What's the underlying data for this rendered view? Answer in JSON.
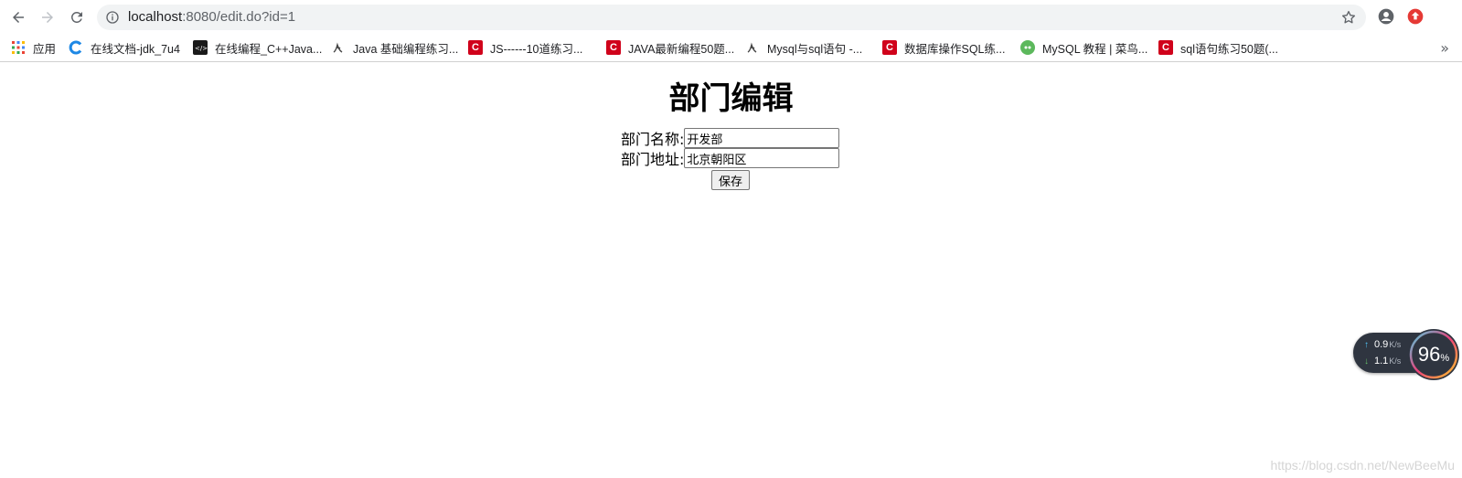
{
  "browser": {
    "url_host": "localhost",
    "url_rest": ":8080/edit.do?id=1"
  },
  "bookmarks": [
    {
      "label": "应用",
      "icon": "apps-grid-icon"
    },
    {
      "label": "在线文档-jdk_7u4",
      "icon": "blue-c-icon"
    },
    {
      "label": "在线编程_C++Java...",
      "icon": "dark-logo-icon"
    },
    {
      "label": "Java 基础编程练习...",
      "icon": "script-icon"
    },
    {
      "label": "JS------10道练习...",
      "icon": "csdn-icon"
    },
    {
      "label": "JAVA最新编程50题...",
      "icon": "csdn-icon"
    },
    {
      "label": "Mysql与sql语句 -...",
      "icon": "script-icon"
    },
    {
      "label": "数据库操作SQL练...",
      "icon": "csdn-icon"
    },
    {
      "label": "MySQL 教程 | 菜鸟...",
      "icon": "runoob-icon"
    },
    {
      "label": "sql语句练习50题(...",
      "icon": "csdn-icon"
    }
  ],
  "page": {
    "title": "部门编辑",
    "form": {
      "name_label": "部门名称:",
      "name_value": "开发部",
      "address_label": "部门地址:",
      "address_value": "北京朝阳区",
      "save_label": "保存"
    }
  },
  "speed_widget": {
    "upload_value": "0.9",
    "upload_unit": "K/s",
    "download_value": "1.1",
    "download_unit": "K/s",
    "percent": "96",
    "percent_symbol": "%"
  },
  "watermark": "https://blog.csdn.net/NewBeeMu",
  "colors": {
    "accent_red": "#d0021b",
    "widget_bg": "#2f3540"
  }
}
